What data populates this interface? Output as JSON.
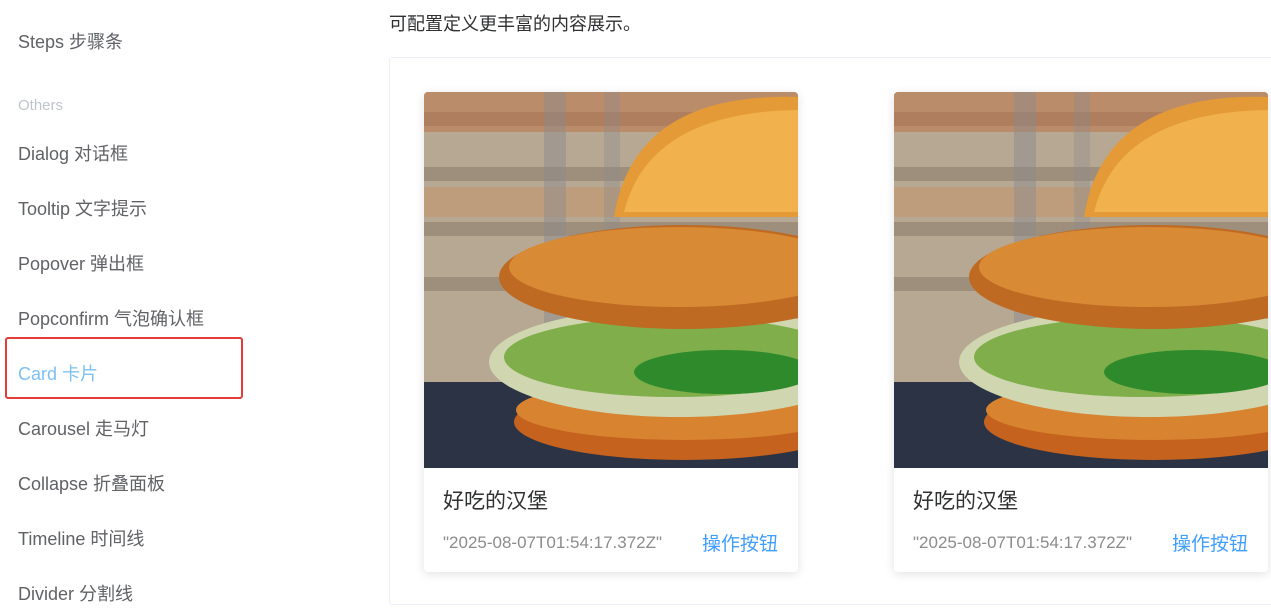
{
  "sidebar": {
    "items": [
      {
        "label": "Steps 步骤条"
      },
      {
        "label": "Dialog 对话框"
      },
      {
        "label": "Tooltip 文字提示"
      },
      {
        "label": "Popover 弹出框"
      },
      {
        "label": "Popconfirm 气泡确认框"
      },
      {
        "label": "Card 卡片"
      },
      {
        "label": "Carousel 走马灯"
      },
      {
        "label": "Collapse 折叠面板"
      },
      {
        "label": "Timeline 时间线"
      },
      {
        "label": "Divider 分割线"
      }
    ],
    "group_title": "Others",
    "active_item": "Card 卡片",
    "active_color": "#7ec0f2",
    "highlight_color": "#e53b3b"
  },
  "main": {
    "intro": "可配置定义更丰富的内容展示。",
    "cards": [
      {
        "image_icon": "burger-photo",
        "title": "好吃的汉堡",
        "time": "\"2025-08-07T01:54:17.372Z\"",
        "button": "操作按钮"
      },
      {
        "image_icon": "burger-photo",
        "title": "好吃的汉堡",
        "time": "\"2025-08-07T01:54:17.372Z\"",
        "button": "操作按钮"
      }
    ],
    "link_color": "#409eff"
  }
}
